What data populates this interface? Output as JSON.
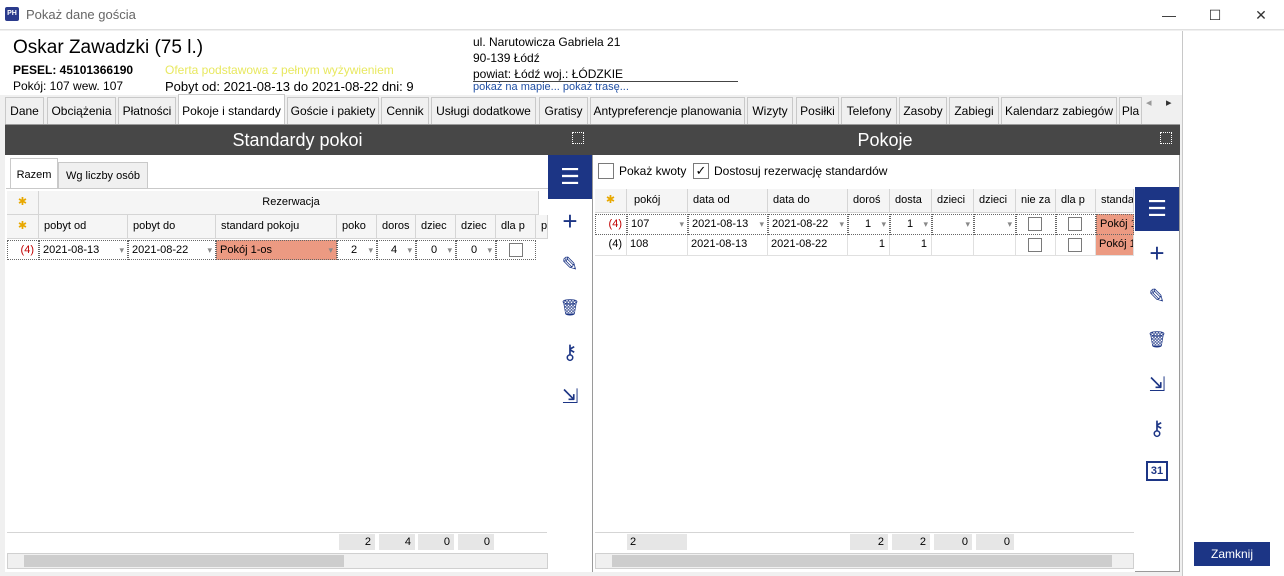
{
  "window": {
    "app_icon_text": "PH",
    "title": "Pokaż dane gościa",
    "minimize": "—",
    "maximize": "☐",
    "close": "✕"
  },
  "guest": {
    "name": "Oskar Zawadzki (75 l.)",
    "pesel": "PESEL: 45101366190",
    "room": "Pokój: 107 wew. 107",
    "offer": "Oferta podstawowa z pełnym wyżywieniem",
    "stay": "Pobyt od: 2021-08-13 do 2021-08-22 dni: 9"
  },
  "address": {
    "line1": "ul. Narutowicza Gabriela 21",
    "line2": "90-139 Łódź",
    "line3": "powiat: Łódź woj.: ŁÓDZKIE",
    "links": "pokaż na mapie... pokaż trasę..."
  },
  "tabs": [
    "Dane",
    "Obciążenia",
    "Płatności",
    "Pokoje i standardy",
    "Goście i pakiety",
    "Cennik",
    "Usługi dodatkowe",
    "Gratisy",
    "Antypreferencje planowania",
    "Wizyty",
    "Posiłki",
    "Telefony",
    "Zasoby",
    "Zabiegi",
    "Kalendarz zabiegów",
    "Pla"
  ],
  "tab_nav": {
    "prev": "◂",
    "next": "▸"
  },
  "left": {
    "title": "Standardy pokoi",
    "subtabs": [
      "Razem",
      "Wg liczby osób"
    ],
    "group_header": "Rezerwacja",
    "star": "✱",
    "columns": [
      "pobyt od",
      "pobyt do",
      "standard pokoju",
      "poko",
      "doros",
      "dziec",
      "dziec",
      "dla p",
      "p"
    ],
    "row": {
      "marker": "(4)",
      "od": "2021-08-13",
      "do": "2021-08-22",
      "standard": "Pokój 1-os",
      "pokoje": "2",
      "doros": "4",
      "dziec1": "0",
      "dziec2": "0"
    },
    "totals": [
      "2",
      "4",
      "0",
      "0"
    ]
  },
  "right": {
    "title": "Pokoje",
    "pokaz_kwoty": "Pokaż kwoty",
    "dostosuj": "Dostosuj rezerwację standardów",
    "dostosuj_check": "✓",
    "star": "✱",
    "columns": [
      "pokój",
      "data od",
      "data do",
      "doroś",
      "dosta",
      "dzieci",
      "dzieci",
      "nie za",
      "dla p",
      "standa"
    ],
    "rows": [
      {
        "marker": "(4)",
        "pokoj": "107",
        "od": "2021-08-13",
        "do": "2021-08-22",
        "dor": "1",
        "dost": "1",
        "std": "Pokój 1"
      },
      {
        "marker": "(4)",
        "pokoj": "108",
        "od": "2021-08-13",
        "do": "2021-08-22",
        "dor": "1",
        "dost": "1",
        "std": "Pokój 1"
      }
    ],
    "totals": {
      "count": "2",
      "vals": [
        "2",
        "2",
        "0",
        "0"
      ]
    }
  },
  "toolbar_icons": {
    "menu": "☰",
    "add": "+",
    "edit": "✎",
    "delete": "🗑",
    "person_key": "⚷",
    "import": "⇲",
    "calendar": "31"
  },
  "close_label": "Zamknij",
  "colors": {
    "accent": "#1c3585",
    "highlight": "#ec9a82",
    "dark_header": "#474747",
    "marker_red": "#c00000"
  }
}
